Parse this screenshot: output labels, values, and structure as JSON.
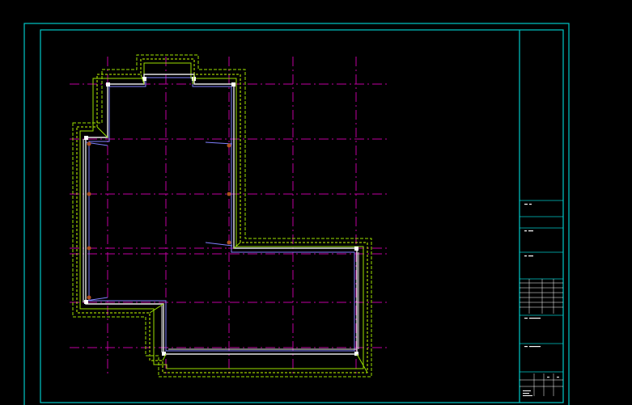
{
  "viewport": {
    "background": "#000000"
  },
  "colors": {
    "frame": "#00c8c8",
    "grid": "#c000a0",
    "wall": "#e6e6e6",
    "wall_inner": "#8080ff",
    "offset_line": "#9be000",
    "offset_dash": "#c8ff00",
    "column_dot": "#b05020",
    "node": "#ffffff"
  },
  "title_block": {
    "field_1": "",
    "field_2": "",
    "field_3": "",
    "field_4": "",
    "field_5": ""
  }
}
